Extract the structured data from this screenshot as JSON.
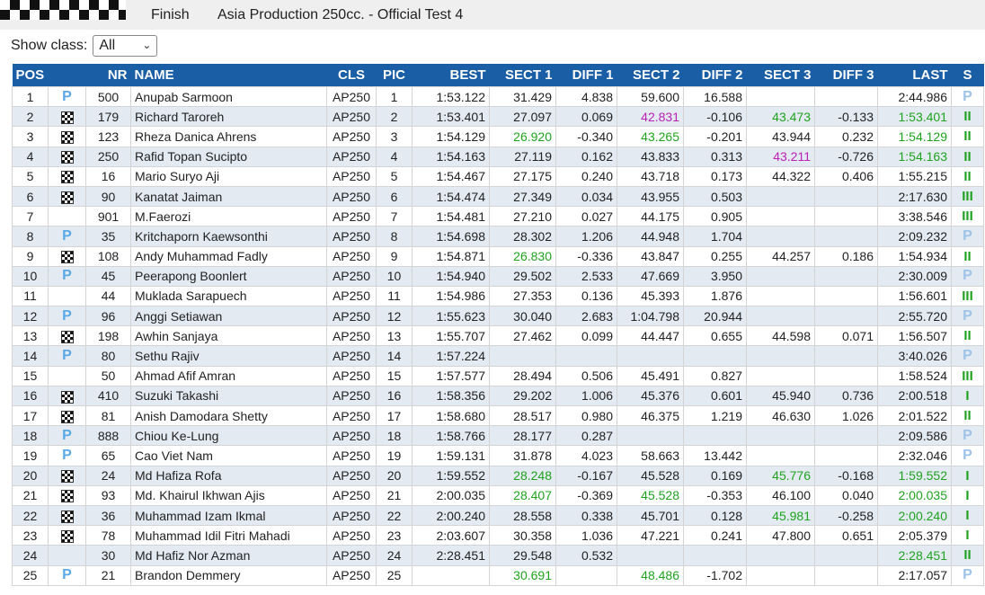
{
  "header": {
    "status": "Finish",
    "title": "Asia Production 250cc. - Official Test 4"
  },
  "filter": {
    "label": "Show class:",
    "value": "All"
  },
  "columns": [
    "POS",
    "",
    "NR",
    "NAME",
    "CLS",
    "PIC",
    "BEST",
    "SECT 1",
    "DIFF 1",
    "SECT 2",
    "DIFF 2",
    "SECT 3",
    "DIFF 3",
    "LAST",
    "S"
  ],
  "colors": {
    "header_bg": "#1a5ea6",
    "row_alt": "#e3eaf2",
    "green": "#1fa31f",
    "purple": "#bb1fb6",
    "pit_blue": "#5aa9e6"
  },
  "rows": [
    {
      "pos": "1",
      "flag": "pit",
      "nr": "500",
      "name": "Anupab Sarmoon",
      "cls": "AP250",
      "pic": "1",
      "best": "1:53.122",
      "s1": "31.429",
      "d1": "4.838",
      "s2": "59.600",
      "d2": "16.588",
      "s3": "",
      "d3": "",
      "last": "2:44.986",
      "s": "P",
      "c": {}
    },
    {
      "pos": "2",
      "flag": "checkered",
      "nr": "179",
      "name": "Richard Taroreh",
      "cls": "AP250",
      "pic": "2",
      "best": "1:53.401",
      "s1": "27.097",
      "d1": "0.069",
      "s2": "42.831",
      "d2": "-0.106",
      "s3": "43.473",
      "d3": "-0.133",
      "last": "1:53.401",
      "s": "II",
      "c": {
        "s2": "purple",
        "s3": "green",
        "last": "green"
      }
    },
    {
      "pos": "3",
      "flag": "checkered",
      "nr": "123",
      "name": "Rheza Danica Ahrens",
      "cls": "AP250",
      "pic": "3",
      "best": "1:54.129",
      "s1": "26.920",
      "d1": "-0.340",
      "s2": "43.265",
      "d2": "-0.201",
      "s3": "43.944",
      "d3": "0.232",
      "last": "1:54.129",
      "s": "II",
      "c": {
        "s1": "green",
        "s2": "green",
        "last": "green"
      }
    },
    {
      "pos": "4",
      "flag": "checkered",
      "nr": "250",
      "name": "Rafid Topan Sucipto",
      "cls": "AP250",
      "pic": "4",
      "best": "1:54.163",
      "s1": "27.119",
      "d1": "0.162",
      "s2": "43.833",
      "d2": "0.313",
      "s3": "43.211",
      "d3": "-0.726",
      "last": "1:54.163",
      "s": "II",
      "c": {
        "s3": "purple",
        "last": "green"
      }
    },
    {
      "pos": "5",
      "flag": "checkered",
      "nr": "16",
      "name": "Mario Suryo Aji",
      "cls": "AP250",
      "pic": "5",
      "best": "1:54.467",
      "s1": "27.175",
      "d1": "0.240",
      "s2": "43.718",
      "d2": "0.173",
      "s3": "44.322",
      "d3": "0.406",
      "last": "1:55.215",
      "s": "II",
      "c": {}
    },
    {
      "pos": "6",
      "flag": "checkered",
      "nr": "90",
      "name": "Kanatat Jaiman",
      "cls": "AP250",
      "pic": "6",
      "best": "1:54.474",
      "s1": "27.349",
      "d1": "0.034",
      "s2": "43.955",
      "d2": "0.503",
      "s3": "",
      "d3": "",
      "last": "2:17.630",
      "s": "III",
      "c": {}
    },
    {
      "pos": "7",
      "flag": "",
      "nr": "901",
      "name": "M.Faerozi",
      "cls": "AP250",
      "pic": "7",
      "best": "1:54.481",
      "s1": "27.210",
      "d1": "0.027",
      "s2": "44.175",
      "d2": "0.905",
      "s3": "",
      "d3": "",
      "last": "3:38.546",
      "s": "III",
      "c": {}
    },
    {
      "pos": "8",
      "flag": "pit",
      "nr": "35",
      "name": "Kritchaporn Kaewsonthi",
      "cls": "AP250",
      "pic": "8",
      "best": "1:54.698",
      "s1": "28.302",
      "d1": "1.206",
      "s2": "44.948",
      "d2": "1.704",
      "s3": "",
      "d3": "",
      "last": "2:09.232",
      "s": "P",
      "c": {}
    },
    {
      "pos": "9",
      "flag": "checkered",
      "nr": "108",
      "name": "Andy Muhammad Fadly",
      "cls": "AP250",
      "pic": "9",
      "best": "1:54.871",
      "s1": "26.830",
      "d1": "-0.336",
      "s2": "43.847",
      "d2": "0.255",
      "s3": "44.257",
      "d3": "0.186",
      "last": "1:54.934",
      "s": "II",
      "c": {
        "s1": "green"
      }
    },
    {
      "pos": "10",
      "flag": "pit",
      "nr": "45",
      "name": "Peerapong Boonlert",
      "cls": "AP250",
      "pic": "10",
      "best": "1:54.940",
      "s1": "29.502",
      "d1": "2.533",
      "s2": "47.669",
      "d2": "3.950",
      "s3": "",
      "d3": "",
      "last": "2:30.009",
      "s": "P",
      "c": {}
    },
    {
      "pos": "11",
      "flag": "",
      "nr": "44",
      "name": "Muklada Sarapuech",
      "cls": "AP250",
      "pic": "11",
      "best": "1:54.986",
      "s1": "27.353",
      "d1": "0.136",
      "s2": "45.393",
      "d2": "1.876",
      "s3": "",
      "d3": "",
      "last": "1:56.601",
      "s": "III",
      "c": {}
    },
    {
      "pos": "12",
      "flag": "pit",
      "nr": "96",
      "name": "Anggi Setiawan",
      "cls": "AP250",
      "pic": "12",
      "best": "1:55.623",
      "s1": "30.040",
      "d1": "2.683",
      "s2": "1:04.798",
      "d2": "20.944",
      "s3": "",
      "d3": "",
      "last": "2:55.720",
      "s": "P",
      "c": {}
    },
    {
      "pos": "13",
      "flag": "checkered",
      "nr": "198",
      "name": "Awhin Sanjaya",
      "cls": "AP250",
      "pic": "13",
      "best": "1:55.707",
      "s1": "27.462",
      "d1": "0.099",
      "s2": "44.447",
      "d2": "0.655",
      "s3": "44.598",
      "d3": "0.071",
      "last": "1:56.507",
      "s": "II",
      "c": {}
    },
    {
      "pos": "14",
      "flag": "pit",
      "nr": "80",
      "name": "Sethu Rajiv",
      "cls": "AP250",
      "pic": "14",
      "best": "1:57.224",
      "s1": "",
      "d1": "",
      "s2": "",
      "d2": "",
      "s3": "",
      "d3": "",
      "last": "3:40.026",
      "s": "P",
      "c": {}
    },
    {
      "pos": "15",
      "flag": "",
      "nr": "50",
      "name": "Ahmad Afif Amran",
      "cls": "AP250",
      "pic": "15",
      "best": "1:57.577",
      "s1": "28.494",
      "d1": "0.506",
      "s2": "45.491",
      "d2": "0.827",
      "s3": "",
      "d3": "",
      "last": "1:58.524",
      "s": "III",
      "c": {}
    },
    {
      "pos": "16",
      "flag": "checkered",
      "nr": "410",
      "name": "Suzuki Takashi",
      "cls": "AP250",
      "pic": "16",
      "best": "1:58.356",
      "s1": "29.202",
      "d1": "1.006",
      "s2": "45.376",
      "d2": "0.601",
      "s3": "45.940",
      "d3": "0.736",
      "last": "2:00.518",
      "s": "I",
      "c": {}
    },
    {
      "pos": "17",
      "flag": "checkered",
      "nr": "81",
      "name": "Anish Damodara Shetty",
      "cls": "AP250",
      "pic": "17",
      "best": "1:58.680",
      "s1": "28.517",
      "d1": "0.980",
      "s2": "46.375",
      "d2": "1.219",
      "s3": "46.630",
      "d3": "1.026",
      "last": "2:01.522",
      "s": "II",
      "c": {}
    },
    {
      "pos": "18",
      "flag": "pit",
      "nr": "888",
      "name": "Chiou Ke-Lung",
      "cls": "AP250",
      "pic": "18",
      "best": "1:58.766",
      "s1": "28.177",
      "d1": "0.287",
      "s2": "",
      "d2": "",
      "s3": "",
      "d3": "",
      "last": "2:09.586",
      "s": "P",
      "c": {}
    },
    {
      "pos": "19",
      "flag": "pit",
      "nr": "65",
      "name": "Cao Viet Nam",
      "cls": "AP250",
      "pic": "19",
      "best": "1:59.131",
      "s1": "31.878",
      "d1": "4.023",
      "s2": "58.663",
      "d2": "13.442",
      "s3": "",
      "d3": "",
      "last": "2:32.046",
      "s": "P",
      "c": {}
    },
    {
      "pos": "20",
      "flag": "checkered",
      "nr": "24",
      "name": "Md Hafiza Rofa",
      "cls": "AP250",
      "pic": "20",
      "best": "1:59.552",
      "s1": "28.248",
      "d1": "-0.167",
      "s2": "45.528",
      "d2": "0.169",
      "s3": "45.776",
      "d3": "-0.168",
      "last": "1:59.552",
      "s": "I",
      "c": {
        "s1": "green",
        "s3": "green",
        "last": "green"
      }
    },
    {
      "pos": "21",
      "flag": "checkered",
      "nr": "93",
      "name": "Md. Khairul Ikhwan Ajis",
      "cls": "AP250",
      "pic": "21",
      "best": "2:00.035",
      "s1": "28.407",
      "d1": "-0.369",
      "s2": "45.528",
      "d2": "-0.353",
      "s3": "46.100",
      "d3": "0.040",
      "last": "2:00.035",
      "s": "I",
      "c": {
        "s1": "green",
        "s2": "green",
        "last": "green"
      }
    },
    {
      "pos": "22",
      "flag": "checkered",
      "nr": "36",
      "name": "Muhammad Izam Ikmal",
      "cls": "AP250",
      "pic": "22",
      "best": "2:00.240",
      "s1": "28.558",
      "d1": "0.338",
      "s2": "45.701",
      "d2": "0.128",
      "s3": "45.981",
      "d3": "-0.258",
      "last": "2:00.240",
      "s": "I",
      "c": {
        "s3": "green",
        "last": "green"
      }
    },
    {
      "pos": "23",
      "flag": "checkered",
      "nr": "78",
      "name": "Muhammad Idil Fitri Mahadi",
      "cls": "AP250",
      "pic": "23",
      "best": "2:03.607",
      "s1": "30.358",
      "d1": "1.036",
      "s2": "47.221",
      "d2": "0.241",
      "s3": "47.800",
      "d3": "0.651",
      "last": "2:05.379",
      "s": "I",
      "c": {}
    },
    {
      "pos": "24",
      "flag": "",
      "nr": "30",
      "name": "Md Hafiz Nor Azman",
      "cls": "AP250",
      "pic": "24",
      "best": "2:28.451",
      "s1": "29.548",
      "d1": "0.532",
      "s2": "",
      "d2": "",
      "s3": "",
      "d3": "",
      "last": "2:28.451",
      "s": "II",
      "c": {
        "last": "green"
      }
    },
    {
      "pos": "25",
      "flag": "pit",
      "nr": "21",
      "name": "Brandon Demmery",
      "cls": "AP250",
      "pic": "25",
      "best": "",
      "s1": "30.691",
      "d1": "",
      "s2": "48.486",
      "d2": "-1.702",
      "s3": "",
      "d3": "",
      "last": "2:17.057",
      "s": "P",
      "c": {
        "s1": "green",
        "s2": "green"
      }
    }
  ]
}
